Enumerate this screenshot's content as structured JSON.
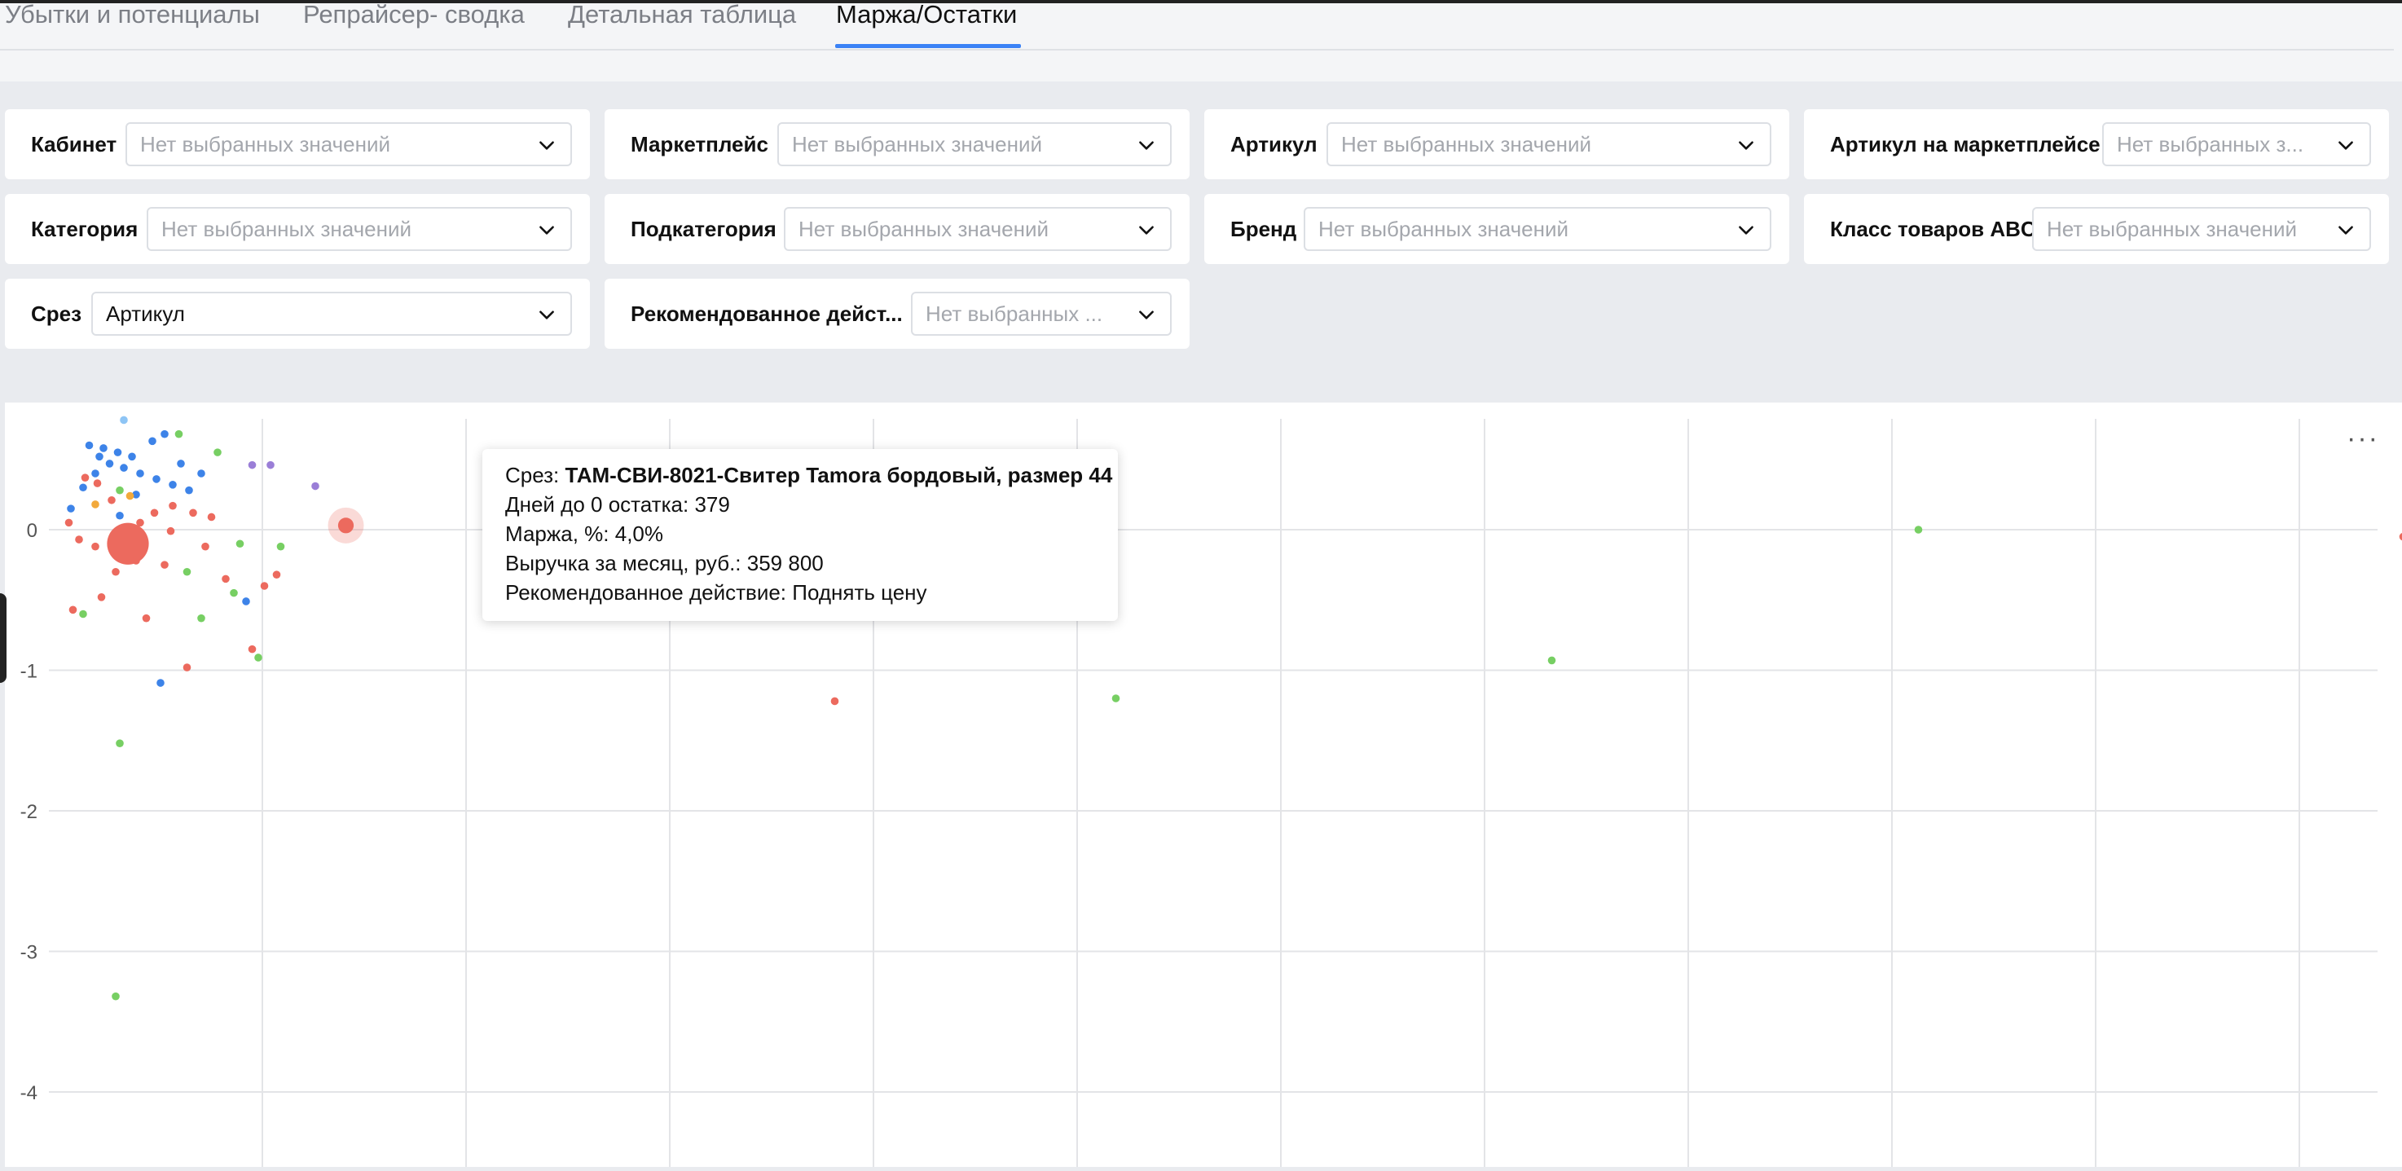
{
  "tabs": [
    {
      "label": "Убытки и потенциалы",
      "active": false
    },
    {
      "label": "Репрайсер- сводка",
      "active": false
    },
    {
      "label": "Детальная таблица",
      "active": false
    },
    {
      "label": "Маржа/Остатки",
      "active": true
    }
  ],
  "filters": {
    "cabinet": {
      "label": "Кабинет",
      "value": "Нет выбранных значений"
    },
    "marketplace": {
      "label": "Маркетплейс",
      "value": "Нет выбранных значений"
    },
    "article": {
      "label": "Артикул",
      "value": "Нет выбранных значений"
    },
    "mp_article": {
      "label": "Артикул на маркетплейсе",
      "value": "Нет выбранных з..."
    },
    "category": {
      "label": "Категория",
      "value": "Нет выбранных значений"
    },
    "subcategory": {
      "label": "Подкатегория",
      "value": "Нет выбранных значений"
    },
    "brand": {
      "label": "Бренд",
      "value": "Нет выбранных значений"
    },
    "abc_class": {
      "label": "Класс товаров ABC",
      "value": "Нет выбранных значений"
    },
    "slice": {
      "label": "Срез",
      "value": "Артикул"
    },
    "action": {
      "label": "Рекомендованное дейст...",
      "value": "Нет выбранных ..."
    }
  },
  "menu_icon": "more-horizontal-icon",
  "chart_data": {
    "type": "scatter",
    "ylim": [
      -4.45,
      0.82
    ],
    "xlim": [
      0,
      11.6
    ],
    "yticks": [
      0,
      -1,
      -2,
      -3,
      -4
    ],
    "ytick_labels": [
      "0",
      "-1",
      "-2",
      "-3",
      "-4"
    ],
    "grid": true,
    "colors": {
      "red": "#ec6a5e",
      "blue": "#3d83e8",
      "green": "#77cf63",
      "orange": "#f2a93b",
      "purple": "#9a7ed7",
      "lightblue": "#8ec5f5"
    },
    "points": [
      {
        "x": 0.34,
        "y": -0.1,
        "c": "red",
        "size": 16
      },
      {
        "x": 1.41,
        "y": 0.03,
        "c": "red",
        "size": 6,
        "highlighted": true
      },
      {
        "x": 0.55,
        "y": -0.01,
        "c": "red",
        "size": 3
      },
      {
        "x": 0.72,
        "y": -0.12,
        "c": "red",
        "size": 3
      },
      {
        "x": 0.82,
        "y": -0.35,
        "c": "red",
        "size": 3
      },
      {
        "x": 0.95,
        "y": -0.85,
        "c": "red",
        "size": 3
      },
      {
        "x": 1.01,
        "y": -0.4,
        "c": "red",
        "size": 3
      },
      {
        "x": 1.07,
        "y": -0.32,
        "c": "red",
        "size": 3
      },
      {
        "x": 0.63,
        "y": -0.98,
        "c": "red",
        "size": 3
      },
      {
        "x": 0.21,
        "y": -0.48,
        "c": "red",
        "size": 3
      },
      {
        "x": 0.28,
        "y": -0.3,
        "c": "red",
        "size": 3
      },
      {
        "x": 0.18,
        "y": -0.12,
        "c": "red",
        "size": 3
      },
      {
        "x": 0.1,
        "y": -0.07,
        "c": "red",
        "size": 3
      },
      {
        "x": 0.05,
        "y": 0.05,
        "c": "red",
        "size": 3
      },
      {
        "x": 0.4,
        "y": 0.05,
        "c": "red",
        "size": 3
      },
      {
        "x": 0.47,
        "y": 0.12,
        "c": "red",
        "size": 3
      },
      {
        "x": 0.56,
        "y": 0.17,
        "c": "red",
        "size": 3
      },
      {
        "x": 0.66,
        "y": 0.12,
        "c": "red",
        "size": 3
      },
      {
        "x": 0.75,
        "y": 0.09,
        "c": "red",
        "size": 3
      },
      {
        "x": 0.52,
        "y": -0.25,
        "c": "red",
        "size": 3
      },
      {
        "x": 0.38,
        "y": -0.22,
        "c": "red",
        "size": 3
      },
      {
        "x": 0.07,
        "y": -0.57,
        "c": "red",
        "size": 3
      },
      {
        "x": 0.43,
        "y": -0.63,
        "c": "red",
        "size": 3
      },
      {
        "x": 0.19,
        "y": 0.33,
        "c": "red",
        "size": 3
      },
      {
        "x": 0.13,
        "y": 0.37,
        "c": "red",
        "size": 3
      },
      {
        "x": 0.26,
        "y": 0.21,
        "c": "red",
        "size": 3
      },
      {
        "x": 3.81,
        "y": -1.22,
        "c": "red",
        "size": 3
      },
      {
        "x": 11.51,
        "y": -0.05,
        "c": "red",
        "size": 3
      },
      {
        "x": 0.15,
        "y": 0.6,
        "c": "blue",
        "size": 3
      },
      {
        "x": 0.22,
        "y": 0.58,
        "c": "blue",
        "size": 3
      },
      {
        "x": 0.29,
        "y": 0.55,
        "c": "blue",
        "size": 3
      },
      {
        "x": 0.36,
        "y": 0.52,
        "c": "blue",
        "size": 3
      },
      {
        "x": 0.25,
        "y": 0.47,
        "c": "blue",
        "size": 3
      },
      {
        "x": 0.32,
        "y": 0.44,
        "c": "blue",
        "size": 3
      },
      {
        "x": 0.4,
        "y": 0.4,
        "c": "blue",
        "size": 3
      },
      {
        "x": 0.48,
        "y": 0.36,
        "c": "blue",
        "size": 3
      },
      {
        "x": 0.56,
        "y": 0.32,
        "c": "blue",
        "size": 3
      },
      {
        "x": 0.64,
        "y": 0.28,
        "c": "blue",
        "size": 3
      },
      {
        "x": 0.18,
        "y": 0.4,
        "c": "blue",
        "size": 3
      },
      {
        "x": 0.12,
        "y": 0.3,
        "c": "blue",
        "size": 3
      },
      {
        "x": 0.46,
        "y": 0.63,
        "c": "blue",
        "size": 3
      },
      {
        "x": 0.52,
        "y": 0.68,
        "c": "blue",
        "size": 3
      },
      {
        "x": 0.7,
        "y": 0.4,
        "c": "blue",
        "size": 3
      },
      {
        "x": 0.38,
        "y": 0.25,
        "c": "blue",
        "size": 3
      },
      {
        "x": 0.3,
        "y": 0.1,
        "c": "blue",
        "size": 3
      },
      {
        "x": 0.92,
        "y": -0.51,
        "c": "blue",
        "size": 3
      },
      {
        "x": 0.5,
        "y": -1.09,
        "c": "blue",
        "size": 3
      },
      {
        "x": 0.06,
        "y": 0.15,
        "c": "blue",
        "size": 3
      },
      {
        "x": 0.6,
        "y": 0.47,
        "c": "blue",
        "size": 3
      },
      {
        "x": 0.2,
        "y": 0.52,
        "c": "blue",
        "size": 3
      },
      {
        "x": 0.78,
        "y": 0.55,
        "c": "green",
        "size": 3
      },
      {
        "x": 1.09,
        "y": -0.12,
        "c": "green",
        "size": 3
      },
      {
        "x": 0.86,
        "y": -0.45,
        "c": "green",
        "size": 3
      },
      {
        "x": 0.7,
        "y": -0.63,
        "c": "green",
        "size": 3
      },
      {
        "x": 0.59,
        "y": 0.68,
        "c": "green",
        "size": 3
      },
      {
        "x": 0.3,
        "y": 0.28,
        "c": "green",
        "size": 3
      },
      {
        "x": 0.89,
        "y": -0.1,
        "c": "green",
        "size": 3
      },
      {
        "x": 0.98,
        "y": -0.91,
        "c": "green",
        "size": 3
      },
      {
        "x": 0.12,
        "y": -0.6,
        "c": "green",
        "size": 3
      },
      {
        "x": 0.3,
        "y": -1.52,
        "c": "green",
        "size": 3
      },
      {
        "x": 0.28,
        "y": -3.32,
        "c": "green",
        "size": 3
      },
      {
        "x": 5.19,
        "y": -1.2,
        "c": "green",
        "size": 3
      },
      {
        "x": 7.33,
        "y": -0.93,
        "c": "green",
        "size": 3
      },
      {
        "x": 9.13,
        "y": 0.0,
        "c": "green",
        "size": 3
      },
      {
        "x": 0.63,
        "y": -0.3,
        "c": "green",
        "size": 3
      },
      {
        "x": 0.18,
        "y": 0.18,
        "c": "orange",
        "size": 3
      },
      {
        "x": 0.35,
        "y": 0.24,
        "c": "orange",
        "size": 3
      },
      {
        "x": 0.32,
        "y": 0.78,
        "c": "lightblue",
        "size": 3
      },
      {
        "x": 0.95,
        "y": 0.46,
        "c": "purple",
        "size": 3
      },
      {
        "x": 1.04,
        "y": 0.46,
        "c": "purple",
        "size": 3
      },
      {
        "x": 1.26,
        "y": 0.31,
        "c": "purple",
        "size": 3
      }
    ],
    "tooltip": {
      "slice_label": "Срез: ",
      "slice_value": "ТАМ-СВИ-8021-Свитер Tamora бордовый, размер 44",
      "days_line": "Дней до 0 остатка: 379",
      "margin_line": "Маржа, %: 4,0%",
      "revenue_line": "Выручка за месяц, руб.: 359 800",
      "action_line": "Рекомендованное действие: Поднять цену"
    }
  }
}
